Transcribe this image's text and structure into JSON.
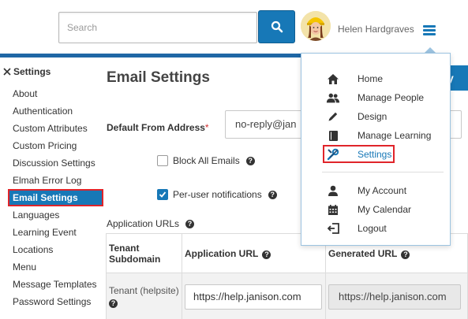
{
  "header": {
    "search_placeholder": "Search",
    "user_name": "Helen Hardgraves"
  },
  "sidebar": {
    "title": "Settings",
    "items": [
      {
        "label": "About"
      },
      {
        "label": "Authentication"
      },
      {
        "label": "Custom Attributes"
      },
      {
        "label": "Custom Pricing"
      },
      {
        "label": "Discussion Settings"
      },
      {
        "label": "Elmah Error Log"
      },
      {
        "label": "Email Settings",
        "active": true
      },
      {
        "label": "Languages"
      },
      {
        "label": "Learning Event"
      },
      {
        "label": "Locations"
      },
      {
        "label": "Menu"
      },
      {
        "label": "Message Templates"
      },
      {
        "label": "Password Settings"
      }
    ]
  },
  "main": {
    "title": "Email Settings",
    "default_from_label": "Default From Address",
    "default_from_required": "*",
    "default_from_value": "no-reply@jan",
    "block_all_label": "Block All Emails",
    "block_all_checked": false,
    "per_user_label": "Per-user notifications",
    "per_user_checked": true,
    "app_urls_title": "Application URLs",
    "save_fragment": "y",
    "table": {
      "headers": [
        "Tenant Subdomain",
        "Application URL",
        "Generated URL"
      ],
      "rows": [
        {
          "tenant": "Tenant (helpsite)",
          "app_url": "https://help.janison.com",
          "generated_url": "https://help.janison.com"
        }
      ]
    }
  },
  "menu": {
    "items": [
      {
        "label": "Home",
        "icon": "home-icon"
      },
      {
        "label": "Manage People",
        "icon": "people-icon"
      },
      {
        "label": "Design",
        "icon": "pencil-icon"
      },
      {
        "label": "Manage Learning",
        "icon": "book-icon"
      },
      {
        "label": "Settings",
        "icon": "wrench-screwdriver-icon",
        "highlighted": true
      },
      {
        "label": "My Account",
        "icon": "user-icon"
      },
      {
        "label": "My Calendar",
        "icon": "calendar-icon"
      },
      {
        "label": "Logout",
        "icon": "logout-icon"
      }
    ]
  },
  "colors": {
    "accent": "#1778b7",
    "highlight_border": "#e0242a",
    "header_bar": "#1f67a5"
  }
}
